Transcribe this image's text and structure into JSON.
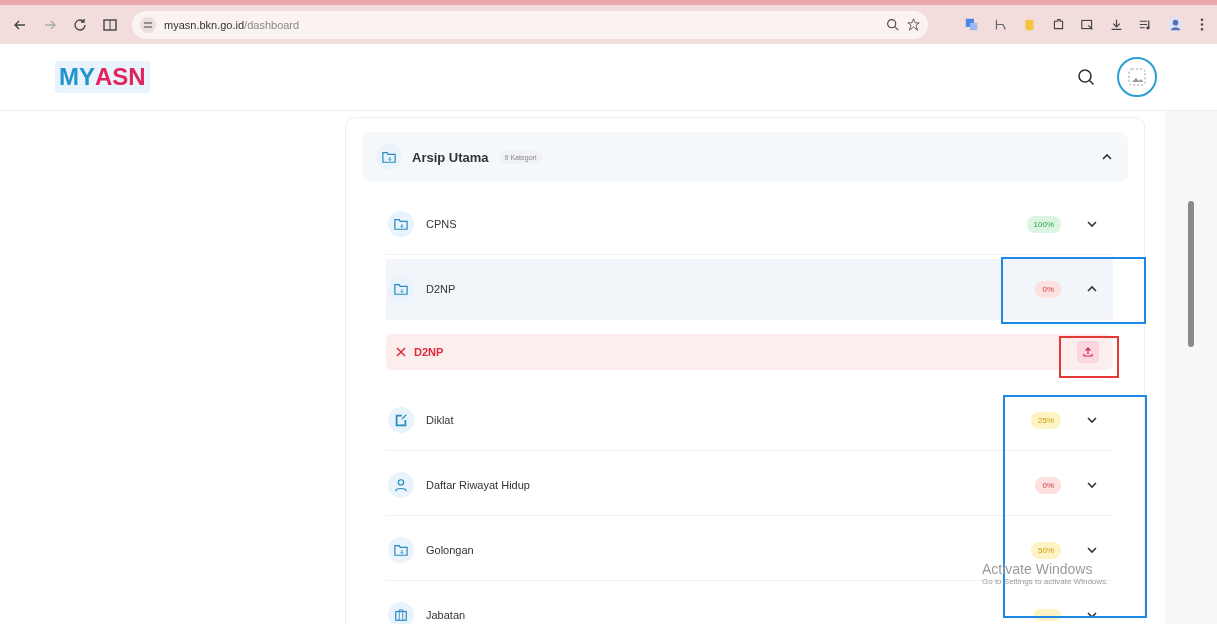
{
  "browser": {
    "url_host": "myasn.bkn.go.id",
    "url_path": "/dashboard"
  },
  "header": {
    "logo_left": "MY",
    "logo_right": "ASN"
  },
  "section": {
    "title": "Arsip Utama",
    "count_badge": "9 Kategori",
    "expanded": true
  },
  "rows": [
    {
      "kind": "folder",
      "label": "CPNS",
      "percent": "100%",
      "color": "#dcf5e3",
      "expanded": false
    },
    {
      "kind": "folder",
      "label": "D2NP",
      "percent": "0%",
      "color": "#fde0e0",
      "expanded": true,
      "documents": [
        {
          "label": "D2NP",
          "complete": false
        }
      ]
    },
    {
      "kind": "edit",
      "label": "Diklat",
      "percent": "25%",
      "color": "#fdf3c4",
      "expanded": false
    },
    {
      "kind": "person",
      "label": "Daftar Riwayat Hidup",
      "percent": "0%",
      "color": "#fde0e0",
      "expanded": false
    },
    {
      "kind": "folder",
      "label": "Golongan",
      "percent": "50%",
      "color": "#fdf3c4",
      "expanded": false
    },
    {
      "kind": "briefcase",
      "label": "Jabatan",
      "color": "#fdf3c4",
      "expanded": false
    }
  ],
  "annotations": [
    {
      "color": "#1e88e5"
    },
    {
      "color": "#e53935"
    },
    {
      "color": "#1e88e5"
    }
  ],
  "os_notice": {
    "title": "Activate Windows",
    "subtitle": "Go to Settings to activate Windows."
  }
}
